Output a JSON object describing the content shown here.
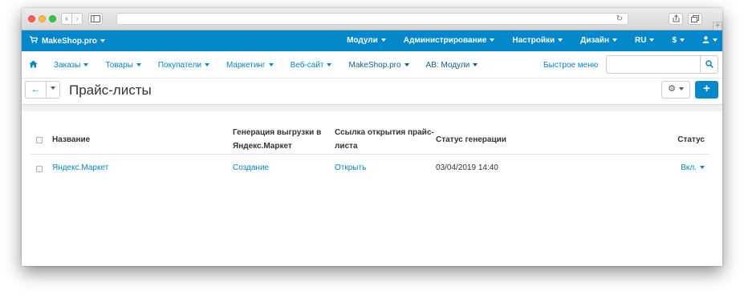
{
  "browser": {
    "back": "‹",
    "forward": "›",
    "reload": "↻",
    "new_tab": "+"
  },
  "topbar": {
    "brand": "MakeShop.pro",
    "menu": [
      "Модули",
      "Администрирование",
      "Настройки",
      "Дизайн",
      "RU",
      "$",
      "👤"
    ],
    "color": "#0388cc"
  },
  "menubar": {
    "items": [
      "Заказы",
      "Товары",
      "Покупатели",
      "Маркетинг",
      "Веб-сайт",
      "MakeShop.pro",
      "AB: Модули"
    ],
    "quick_menu": "Быстрое меню",
    "search_placeholder": ""
  },
  "titlebar": {
    "title": "Прайс-листы",
    "back": "←",
    "gear": "⚙",
    "add": "+"
  },
  "table": {
    "headers": {
      "name": "Название",
      "generation_line1": "Генерация выгрузки в",
      "generation_line2": "Яндекс.Маркет",
      "link_line1": "Ссылка открытия прайс-",
      "link_line2": "листа",
      "gen_status": "Статус генерации",
      "status": "Статус"
    },
    "rows": [
      {
        "name": "Яндекс.Маркет",
        "generation": "Создание",
        "link": "Открыть",
        "gen_status": "03/04/2019 14:40",
        "status": "Вкл."
      }
    ]
  }
}
